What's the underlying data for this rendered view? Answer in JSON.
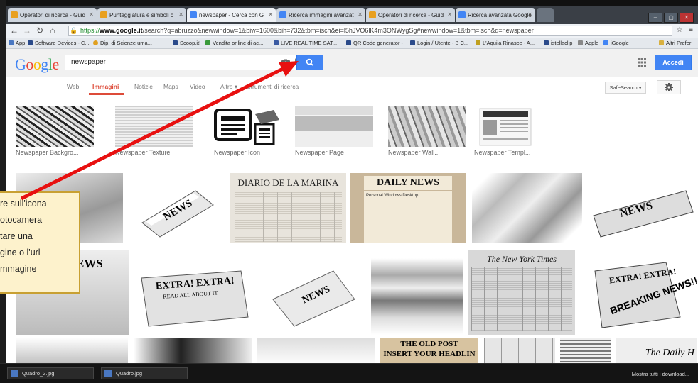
{
  "tabs": [
    {
      "label": "Operatori di ricerca - Guid",
      "icon": "people-icon",
      "color": "#e8a020"
    },
    {
      "label": "Punteggiatura e simboli c",
      "icon": "people-icon",
      "color": "#e8a020"
    },
    {
      "label": "newspaper - Cerca con G",
      "icon": "google-icon",
      "color": "#4285f4"
    },
    {
      "label": "Ricerca immagini avanzat",
      "icon": "google-icon",
      "color": "#4285f4"
    },
    {
      "label": "Operatori di ricerca - Guid",
      "icon": "people-icon",
      "color": "#e8a020"
    },
    {
      "label": "Ricerca avanzata Google",
      "icon": "google-icon",
      "color": "#4285f4"
    }
  ],
  "address": {
    "url_prefix": "https://",
    "url_domain": "www.google.it",
    "url_path": "/search?q=abruzzo&newwindow=1&biw=1600&bih=732&tbm=isch&ei=l5hJVO6lK4m3ONWygSg#newwindow=1&tbm=isch&q=newspaper"
  },
  "bookmarks": [
    "App",
    "Software Devices - C...",
    "Dip. di Scienze uma...",
    "Scoop.it!",
    "Vendita online di ac...",
    "LIVE REAL TIME SAT...",
    "QR Code generator -",
    "Login / Utente - B C...",
    "L'Aquila Rinasce - A...",
    "istellaclip",
    "Apple",
    "iGoogle",
    "Altri Prefer"
  ],
  "google": {
    "logo": "Google",
    "query": "newspaper",
    "login_label": "Accedi"
  },
  "nav": {
    "tabs": [
      "Web",
      "Immagini",
      "Notizie",
      "Maps",
      "Video",
      "Altro ▾",
      "Strumenti di ricerca"
    ],
    "safesearch": "SafeSearch ▾"
  },
  "suggestions": [
    "Newspaper Backgro...",
    "Newspaper Texture",
    "Newspaper Icon",
    "Newspaper Page",
    "Newspaper Wall...",
    "Newspaper Templ..."
  ],
  "results_text": {
    "diario": "DIARIO DE LA MARINA",
    "daily_news": "DAILY NEWS",
    "personal": "Personal Windows Desktop",
    "news1": "NEWS",
    "news2": "NEWS",
    "extra1": "EXTRA! EXTRA!",
    "extra1b": "READ ALL ABOUT IT",
    "news3": "NEWS",
    "times": "The New York Times",
    "extra2": "EXTRA! EXTRA!",
    "breaking": "BREAKING NEWS!!!",
    "ews": "EWS",
    "old_post": "THE OLD POST",
    "insert": "INSERT YOUR HEADLIN",
    "daily_h": "The Daily H"
  },
  "callout": {
    "lines": [
      "re sull'icona",
      "otocamera",
      "tare una",
      "gine o l'url",
      "mmagine"
    ]
  },
  "taskbar": {
    "items": [
      "Quadro_2.jpg",
      "Quadro.jpg"
    ],
    "download": "Mostra tutti i download..."
  },
  "colors": {
    "accent": "#4285f4",
    "active_tab": "#dd4b39",
    "arrow": "#e81010",
    "callout_bg": "#fdf2cc"
  }
}
